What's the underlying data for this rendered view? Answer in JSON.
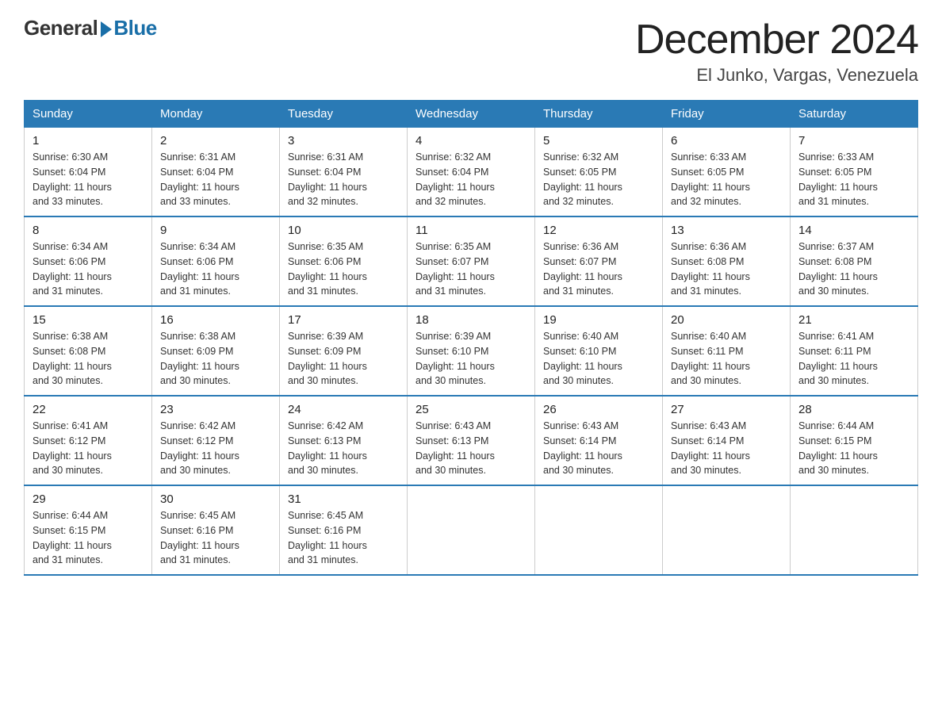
{
  "logo": {
    "general": "General",
    "blue": "Blue"
  },
  "title": "December 2024",
  "location": "El Junko, Vargas, Venezuela",
  "days_of_week": [
    "Sunday",
    "Monday",
    "Tuesday",
    "Wednesday",
    "Thursday",
    "Friday",
    "Saturday"
  ],
  "weeks": [
    [
      {
        "day": "1",
        "sunrise": "6:30 AM",
        "sunset": "6:04 PM",
        "daylight": "11 hours and 33 minutes."
      },
      {
        "day": "2",
        "sunrise": "6:31 AM",
        "sunset": "6:04 PM",
        "daylight": "11 hours and 33 minutes."
      },
      {
        "day": "3",
        "sunrise": "6:31 AM",
        "sunset": "6:04 PM",
        "daylight": "11 hours and 32 minutes."
      },
      {
        "day": "4",
        "sunrise": "6:32 AM",
        "sunset": "6:04 PM",
        "daylight": "11 hours and 32 minutes."
      },
      {
        "day": "5",
        "sunrise": "6:32 AM",
        "sunset": "6:05 PM",
        "daylight": "11 hours and 32 minutes."
      },
      {
        "day": "6",
        "sunrise": "6:33 AM",
        "sunset": "6:05 PM",
        "daylight": "11 hours and 32 minutes."
      },
      {
        "day": "7",
        "sunrise": "6:33 AM",
        "sunset": "6:05 PM",
        "daylight": "11 hours and 31 minutes."
      }
    ],
    [
      {
        "day": "8",
        "sunrise": "6:34 AM",
        "sunset": "6:06 PM",
        "daylight": "11 hours and 31 minutes."
      },
      {
        "day": "9",
        "sunrise": "6:34 AM",
        "sunset": "6:06 PM",
        "daylight": "11 hours and 31 minutes."
      },
      {
        "day": "10",
        "sunrise": "6:35 AM",
        "sunset": "6:06 PM",
        "daylight": "11 hours and 31 minutes."
      },
      {
        "day": "11",
        "sunrise": "6:35 AM",
        "sunset": "6:07 PM",
        "daylight": "11 hours and 31 minutes."
      },
      {
        "day": "12",
        "sunrise": "6:36 AM",
        "sunset": "6:07 PM",
        "daylight": "11 hours and 31 minutes."
      },
      {
        "day": "13",
        "sunrise": "6:36 AM",
        "sunset": "6:08 PM",
        "daylight": "11 hours and 31 minutes."
      },
      {
        "day": "14",
        "sunrise": "6:37 AM",
        "sunset": "6:08 PM",
        "daylight": "11 hours and 30 minutes."
      }
    ],
    [
      {
        "day": "15",
        "sunrise": "6:38 AM",
        "sunset": "6:08 PM",
        "daylight": "11 hours and 30 minutes."
      },
      {
        "day": "16",
        "sunrise": "6:38 AM",
        "sunset": "6:09 PM",
        "daylight": "11 hours and 30 minutes."
      },
      {
        "day": "17",
        "sunrise": "6:39 AM",
        "sunset": "6:09 PM",
        "daylight": "11 hours and 30 minutes."
      },
      {
        "day": "18",
        "sunrise": "6:39 AM",
        "sunset": "6:10 PM",
        "daylight": "11 hours and 30 minutes."
      },
      {
        "day": "19",
        "sunrise": "6:40 AM",
        "sunset": "6:10 PM",
        "daylight": "11 hours and 30 minutes."
      },
      {
        "day": "20",
        "sunrise": "6:40 AM",
        "sunset": "6:11 PM",
        "daylight": "11 hours and 30 minutes."
      },
      {
        "day": "21",
        "sunrise": "6:41 AM",
        "sunset": "6:11 PM",
        "daylight": "11 hours and 30 minutes."
      }
    ],
    [
      {
        "day": "22",
        "sunrise": "6:41 AM",
        "sunset": "6:12 PM",
        "daylight": "11 hours and 30 minutes."
      },
      {
        "day": "23",
        "sunrise": "6:42 AM",
        "sunset": "6:12 PM",
        "daylight": "11 hours and 30 minutes."
      },
      {
        "day": "24",
        "sunrise": "6:42 AM",
        "sunset": "6:13 PM",
        "daylight": "11 hours and 30 minutes."
      },
      {
        "day": "25",
        "sunrise": "6:43 AM",
        "sunset": "6:13 PM",
        "daylight": "11 hours and 30 minutes."
      },
      {
        "day": "26",
        "sunrise": "6:43 AM",
        "sunset": "6:14 PM",
        "daylight": "11 hours and 30 minutes."
      },
      {
        "day": "27",
        "sunrise": "6:43 AM",
        "sunset": "6:14 PM",
        "daylight": "11 hours and 30 minutes."
      },
      {
        "day": "28",
        "sunrise": "6:44 AM",
        "sunset": "6:15 PM",
        "daylight": "11 hours and 30 minutes."
      }
    ],
    [
      {
        "day": "29",
        "sunrise": "6:44 AM",
        "sunset": "6:15 PM",
        "daylight": "11 hours and 31 minutes."
      },
      {
        "day": "30",
        "sunrise": "6:45 AM",
        "sunset": "6:16 PM",
        "daylight": "11 hours and 31 minutes."
      },
      {
        "day": "31",
        "sunrise": "6:45 AM",
        "sunset": "6:16 PM",
        "daylight": "11 hours and 31 minutes."
      },
      null,
      null,
      null,
      null
    ]
  ],
  "labels": {
    "sunrise": "Sunrise:",
    "sunset": "Sunset:",
    "daylight": "Daylight:"
  }
}
